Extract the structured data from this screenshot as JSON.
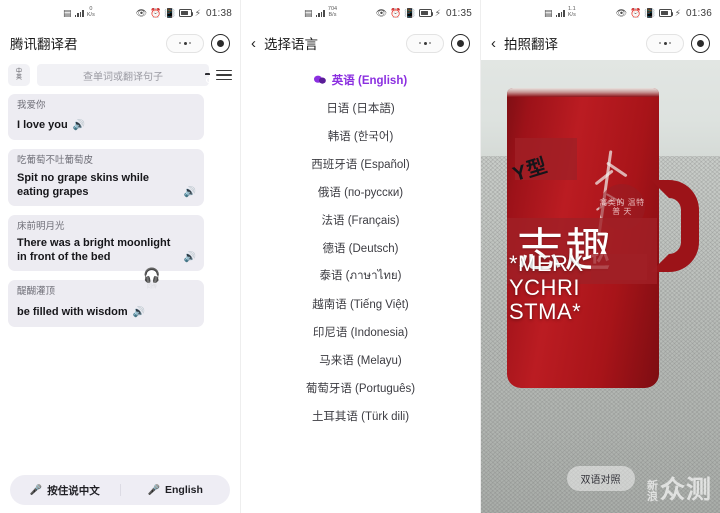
{
  "screens": [
    {
      "id": "translate-home",
      "status": {
        "rate": "0",
        "rate_unit": "K/s",
        "time": "01:38"
      },
      "nav": {
        "title": "腾讯翻译君",
        "back": ""
      },
      "search": {
        "toggle_top": "中",
        "toggle_bottom": "英",
        "placeholder": "查单词或翻译句子"
      },
      "bubbles": [
        {
          "source": "我爱你",
          "target": "I love you",
          "inline": true
        },
        {
          "source": "吃葡萄不吐葡萄皮",
          "target": "Spit no grape skins while eating grapes",
          "inline": false
        },
        {
          "source": "床前明月光",
          "target": "There was a bright moonlight in front of the bed",
          "inline": false
        },
        {
          "source": "醍醐灌顶",
          "target": "be filled with wisdom",
          "inline": true
        }
      ],
      "headset": {
        "label": "同传"
      },
      "footer": {
        "left_label": "按住说中文",
        "right_label": "English"
      }
    },
    {
      "id": "select-language",
      "status": {
        "rate": "704",
        "rate_unit": "B/s",
        "time": "01:35"
      },
      "nav": {
        "title": "选择语言",
        "back": "‹"
      },
      "languages": [
        {
          "label": "英语 (English)",
          "selected": true
        },
        {
          "label": "日语 (日本語)",
          "selected": false
        },
        {
          "label": "韩语 (한국어)",
          "selected": false
        },
        {
          "label": "西班牙语 (Español)",
          "selected": false
        },
        {
          "label": "俄语 (по-русски)",
          "selected": false
        },
        {
          "label": "法语 (Français)",
          "selected": false
        },
        {
          "label": "德语 (Deutsch)",
          "selected": false
        },
        {
          "label": "泰语 (ภาษาไทย)",
          "selected": false
        },
        {
          "label": "越南语 (Tiếng Việt)",
          "selected": false
        },
        {
          "label": "印尼语 (Indonesia)",
          "selected": false
        },
        {
          "label": "马来语 (Melayu)",
          "selected": false
        },
        {
          "label": "葡萄牙语 (Português)",
          "selected": false
        },
        {
          "label": "土耳其语 (Türk dili)",
          "selected": false
        }
      ],
      "accent_color": "#8b2fe0"
    },
    {
      "id": "photo-translate",
      "status": {
        "rate": "1.1",
        "rate_unit": "K/s",
        "time": "01:36"
      },
      "nav": {
        "title": "拍照翻译",
        "back": "‹"
      },
      "ar_overlay": {
        "cn_small": "Y型",
        "cn_big": "志趣",
        "en_line1": "*MERX",
        "en_line2": "YCHRI",
        "en_line3": "STMA*",
        "stamp": "禽类的 温特普 天"
      },
      "bilingual_button": "双语对照",
      "watermark": {
        "small_top": "新",
        "small_bottom": "浪",
        "big": "众测"
      }
    }
  ]
}
